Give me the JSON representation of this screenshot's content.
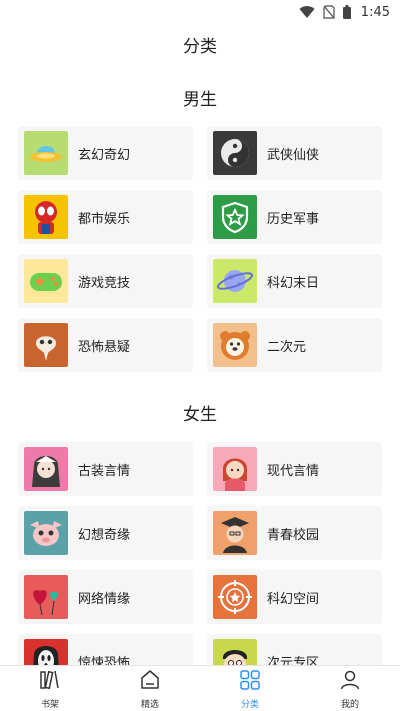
{
  "status_bar": {
    "time": "1:45"
  },
  "page_title": "分类",
  "sections": [
    {
      "title": "男生",
      "items": [
        {
          "label": "玄幻奇幻",
          "icon": "ufo-icon",
          "color": "#b6dc72"
        },
        {
          "label": "武侠仙侠",
          "icon": "yin-yang-icon",
          "color": "#3a3a3a"
        },
        {
          "label": "都市娱乐",
          "icon": "spiderman-icon",
          "color": "#f6c300"
        },
        {
          "label": "历史军事",
          "icon": "shield-star-icon",
          "color": "#2e9b47"
        },
        {
          "label": "游戏竞技",
          "icon": "gamepad-icon",
          "color": "#ffe89a"
        },
        {
          "label": "科幻末日",
          "icon": "planet-icon",
          "color": "#cbe86b"
        },
        {
          "label": "恐怖悬疑",
          "icon": "ghost-icon",
          "color": "#c8652e"
        },
        {
          "label": "二次元",
          "icon": "bear-icon",
          "color": "#f2c08b"
        }
      ]
    },
    {
      "title": "女生",
      "items": [
        {
          "label": "古装言情",
          "icon": "ancient-woman-icon",
          "color": "#f07aa7"
        },
        {
          "label": "现代言情",
          "icon": "modern-woman-icon",
          "color": "#f7a9b9"
        },
        {
          "label": "幻想奇缘",
          "icon": "fantasy-creature-icon",
          "color": "#5aa1a8"
        },
        {
          "label": "青春校园",
          "icon": "graduate-icon",
          "color": "#f0a06a"
        },
        {
          "label": "网络情缘",
          "icon": "hearts-balloon-icon",
          "color": "#e95b5b"
        },
        {
          "label": "科幻空间",
          "icon": "compass-star-icon",
          "color": "#e5733e"
        },
        {
          "label": "惊悚恐怖",
          "icon": "scream-mask-icon",
          "color": "#d8322f"
        },
        {
          "label": "次元专区",
          "icon": "anime-boy-icon",
          "color": "#c9d84b"
        }
      ]
    }
  ],
  "tabs": [
    {
      "label": "书架",
      "icon": "bookshelf-icon",
      "active": false
    },
    {
      "label": "精选",
      "icon": "home-icon",
      "active": false
    },
    {
      "label": "分类",
      "icon": "category-grid-icon",
      "active": true
    },
    {
      "label": "我的",
      "icon": "user-icon",
      "active": false
    }
  ],
  "colors": {
    "accent": "#2f8ef4",
    "card_bg": "#f6f6f6"
  }
}
